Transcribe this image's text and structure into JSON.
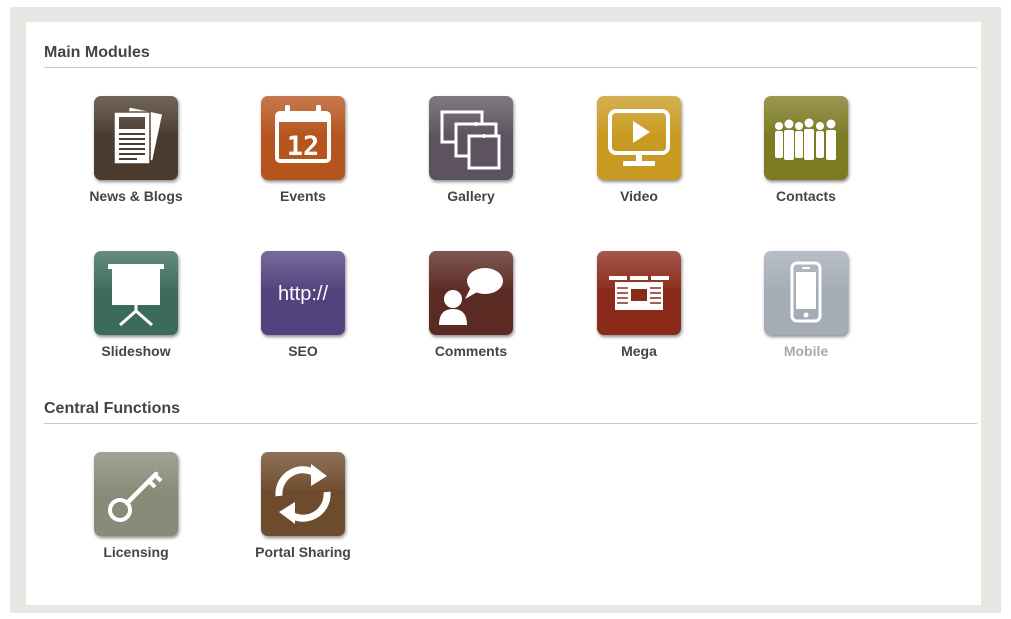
{
  "sections": {
    "main": {
      "title": "Main Modules"
    },
    "central": {
      "title": "Central Functions"
    }
  },
  "modules": [
    {
      "label": "News & Blogs",
      "icon": "newspaper-icon",
      "color": "#4a3b2e"
    },
    {
      "label": "Events",
      "icon": "calendar-icon",
      "color": "#b5541c",
      "calendar_day": "12"
    },
    {
      "label": "Gallery",
      "icon": "gallery-icon",
      "color": "#5d5360"
    },
    {
      "label": "Video",
      "icon": "video-monitor-icon",
      "color": "#c99a22"
    },
    {
      "label": "Contacts",
      "icon": "people-icon",
      "color": "#7d7a24"
    },
    {
      "label": "Slideshow",
      "icon": "projector-screen-icon",
      "color": "#3c6b5e"
    },
    {
      "label": "SEO",
      "icon": "http-icon",
      "color": "#52427e",
      "icon_text": "http://"
    },
    {
      "label": "Comments",
      "icon": "comment-bubble-icon",
      "color": "#5b2a22"
    },
    {
      "label": "Mega",
      "icon": "mega-layout-icon",
      "color": "#8a2a1a"
    },
    {
      "label": "Mobile",
      "icon": "smartphone-icon",
      "color": "#a4acb5",
      "disabled": true
    }
  ],
  "central_functions": [
    {
      "label": "Licensing",
      "icon": "key-icon",
      "color": "#8a8a78"
    },
    {
      "label": "Portal Sharing",
      "icon": "sync-arrows-icon",
      "color": "#6e4b2c"
    }
  ]
}
